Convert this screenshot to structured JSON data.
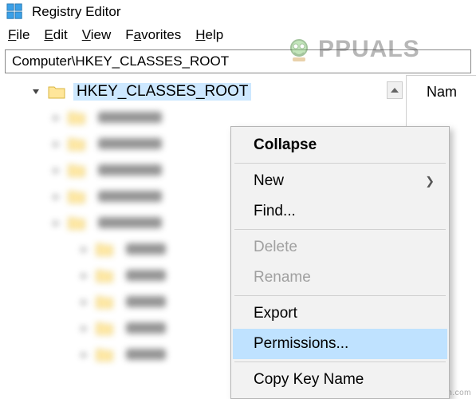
{
  "titlebar": {
    "title": "Registry Editor"
  },
  "menubar": {
    "file": "File",
    "edit": "Edit",
    "view": "View",
    "favorites": "Favorites",
    "help": "Help"
  },
  "addressbar": {
    "path": "Computer\\HKEY_CLASSES_ROOT"
  },
  "tree": {
    "selected_key": "HKEY_CLASSES_ROOT"
  },
  "list": {
    "column_name": "Nam"
  },
  "context_menu": {
    "collapse": "Collapse",
    "new": "New",
    "find": "Find...",
    "delete": "Delete",
    "rename": "Rename",
    "export": "Export",
    "permissions": "Permissions...",
    "copy_key_name": "Copy Key Name"
  },
  "brand": {
    "text": "PPUALS"
  },
  "watermark": {
    "text": "wsxdn.com"
  }
}
